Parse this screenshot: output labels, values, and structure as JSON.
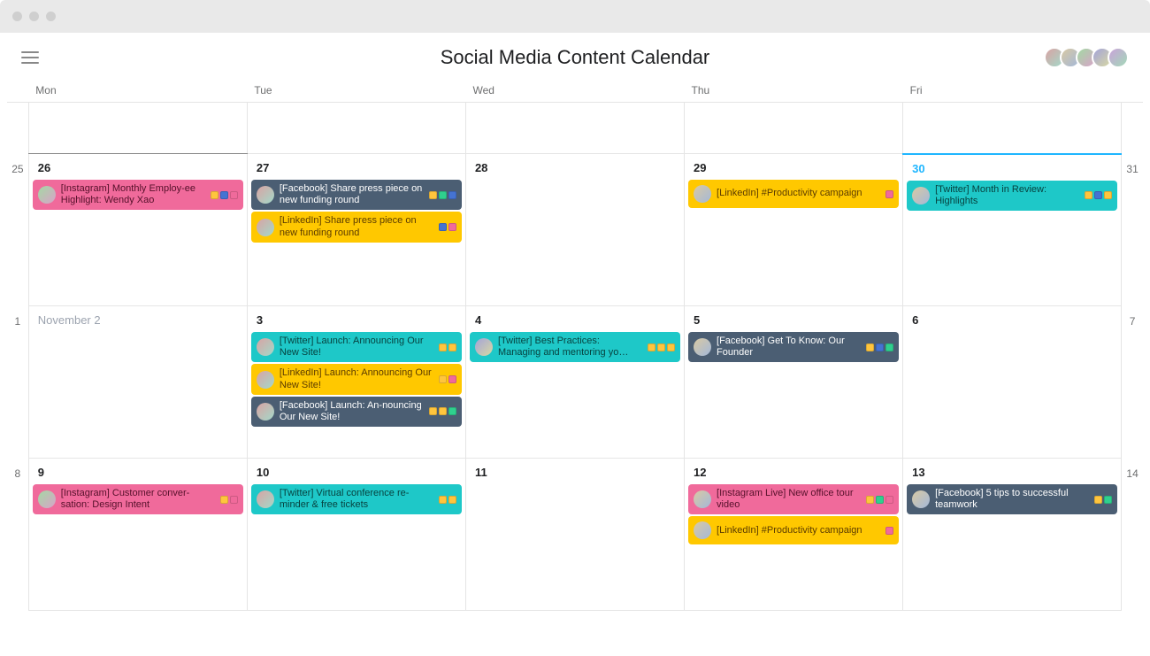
{
  "title": "Social Media Content Calendar",
  "weekday_headers": {
    "d1": "Mon",
    "d2": "Tue",
    "d3": "Wed",
    "d4": "Thu",
    "d5": "Fri"
  },
  "gutters": {
    "r2l": "25",
    "r2r": "31",
    "r3l": "1",
    "r3r": "7",
    "r4l": "8",
    "r4r": "14"
  },
  "dates": {
    "r2d1": "26",
    "r2d2": "27",
    "r2d3": "28",
    "r2d4": "29",
    "r2d5": "30",
    "r3d1": "November 2",
    "r3d2": "3",
    "r3d3": "4",
    "r3d4": "5",
    "r3d5": "6",
    "r4d1": "9",
    "r4d2": "10",
    "r4d3": "11",
    "r4d4": "12",
    "r4d5": "13"
  },
  "events": {
    "e1": "[Instagram] Monthly Employ-ee Highlight: Wendy Xao",
    "e2": "[Facebook] Share press piece on new funding round",
    "e3": "[LinkedIn] Share press piece on new funding round",
    "e4": "[LinkedIn] #Productivity campaign",
    "e5": "[Twitter] Month in Review: Highlights",
    "e6": "[Twitter] Launch: Announcing Our New Site!",
    "e7": "[LinkedIn] Launch: Announcing Our New Site!",
    "e8": "[Facebook] Launch: An-nouncing Our New Site!",
    "e9": "[Twitter] Best Practices: Managing and mentoring yo…",
    "e10": "[Facebook] Get To Know: Our Founder",
    "e11": "[Instagram] Customer conver-sation: Design Intent",
    "e12": "[Twitter] Virtual conference re-minder & free tickets",
    "e13": "[Instagram Live] New office tour video",
    "e14": "[LinkedIn] #Productivity campaign",
    "e15": "[Facebook] 5 tips to successful teamwork"
  }
}
